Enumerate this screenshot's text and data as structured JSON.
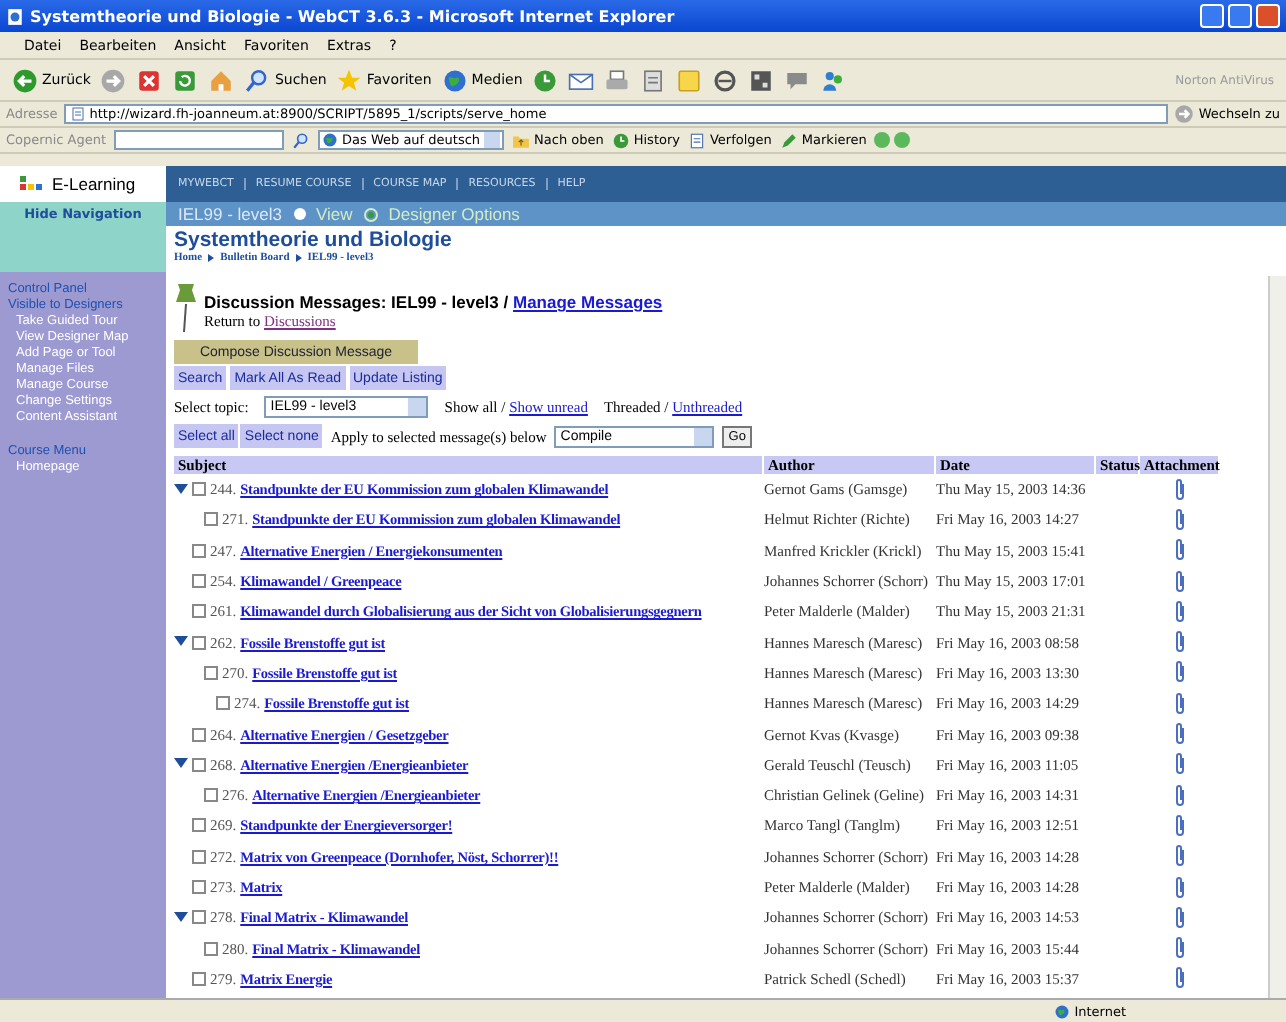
{
  "browser": {
    "title": "Systemtheorie und Biologie - WebCT 3.6.3 - Microsoft Internet Explorer",
    "menu": [
      "Datei",
      "Bearbeiten",
      "Ansicht",
      "Favoriten",
      "Extras",
      "?"
    ],
    "toolbar": [
      {
        "kind": "back",
        "label": "Zurück"
      },
      {
        "kind": "forward"
      },
      {
        "kind": "stop"
      },
      {
        "kind": "refresh"
      },
      {
        "kind": "home"
      },
      {
        "kind": "search",
        "label": "Suchen"
      },
      {
        "kind": "favorites",
        "label": "Favoriten"
      },
      {
        "kind": "media",
        "label": "Medien"
      },
      {
        "kind": "history"
      },
      {
        "kind": "mail"
      },
      {
        "kind": "print"
      },
      {
        "kind": "edit"
      },
      {
        "kind": "note"
      },
      {
        "kind": "ring"
      },
      {
        "kind": "grid"
      },
      {
        "kind": "chat"
      },
      {
        "kind": "people"
      }
    ],
    "norton": "Norton AntiVirus",
    "address_label": "Adresse",
    "url": "http://wizard.fh-joanneum.at:8900/SCRIPT/5895_1/scripts/serve_home",
    "go": "Wechseln zu",
    "copernic": {
      "label": "Copernic Agent",
      "engine": "Das Web auf deutsch",
      "buttons": [
        {
          "kind": "up",
          "label": "Nach oben"
        },
        {
          "kind": "history",
          "label": "History"
        },
        {
          "kind": "track",
          "label": "Verfolgen"
        },
        {
          "kind": "mark",
          "label": "Markieren"
        }
      ]
    },
    "status": "Internet"
  },
  "header": {
    "logo": "E-Learning",
    "nav": [
      "MYWEBCT",
      "RESUME COURSE",
      "COURSE MAP",
      "RESOURCES",
      "HELP"
    ],
    "hide_nav": "Hide Navigation",
    "course_code": "IEL99 - level3",
    "modes": [
      {
        "label": "View",
        "selected": false
      },
      {
        "label": "Designer Options",
        "selected": true
      }
    ]
  },
  "sidebar": {
    "sections": [
      {
        "items": [
          "Control Panel",
          "Visible to Designers"
        ],
        "children": [
          "Take Guided Tour",
          "View Designer Map",
          "Add Page or Tool",
          "Manage Files",
          "Manage Course",
          "Change Settings",
          "Content Assistant"
        ]
      },
      {
        "items": [
          "Course Menu"
        ],
        "children": [
          "Homepage"
        ]
      }
    ]
  },
  "page": {
    "course_title": "Systemtheorie und Biologie",
    "breadcrumb": [
      "Home",
      "Bulletin Board",
      "IEL99 - level3"
    ],
    "heading": "Discussion Messages: IEL99 - level3 / ",
    "heading_link": "Manage Messages",
    "return_text": "Return to ",
    "return_link": "Discussions",
    "compose": "Compose Discussion Message",
    "actions": [
      "Search",
      "Mark All As Read",
      "Update Listing"
    ],
    "topic_label": "Select topic:",
    "topic_value": "IEL99 - level3",
    "show_all": "Show all / ",
    "show_unread": "Show unread",
    "threaded": "Threaded / ",
    "unthreaded": "Unthreaded",
    "select_buttons": [
      "Select all",
      "Select none"
    ],
    "apply_label": "Apply to selected message(s) below",
    "apply_value": "Compile",
    "apply_go": "Go"
  },
  "table": {
    "columns": [
      "Subject",
      "Author",
      "Date",
      "Status",
      "Attachment"
    ],
    "messages": [
      {
        "number": "244.",
        "subject": "Standpunkte der EU Kommission zum globalen Klimawandel",
        "author": "Gernot Gams (Gamsge)",
        "date": "Thu May 15, 2003 14:36",
        "checked": false,
        "attachment": true,
        "expanded": true,
        "children": [
          {
            "number": "271.",
            "subject": "Standpunkte der EU Kommission zum globalen Klimawandel",
            "author": "Helmut Richter (Richte)",
            "date": "Fri May 16, 2003 14:27",
            "checked": false,
            "attachment": true
          }
        ]
      },
      {
        "number": "247.",
        "subject": "Alternative Energien / Energiekonsumenten",
        "author": "Manfred Krickler (Krickl)",
        "date": "Thu May 15, 2003 15:41",
        "checked": false,
        "attachment": true
      },
      {
        "number": "254.",
        "subject": "Klimawandel / Greenpeace",
        "author": "Johannes Schorrer (Schorr)",
        "date": "Thu May 15, 2003 17:01",
        "checked": false,
        "attachment": true
      },
      {
        "number": "261.",
        "subject": "Klimawandel durch Globalisierung aus der Sicht von Globalisierungsgegnern",
        "author": "Peter Malderle (Malder)",
        "date": "Thu May 15, 2003 21:31",
        "checked": false,
        "attachment": true
      },
      {
        "number": "262.",
        "subject": "Fossile Brenstoffe gut ist",
        "author": "Hannes Maresch (Maresc)",
        "date": "Fri May 16, 2003 08:58",
        "checked": false,
        "attachment": true,
        "expanded": true,
        "children": [
          {
            "number": "270.",
            "subject": "Fossile Brenstoffe gut ist",
            "author": "Hannes Maresch (Maresc)",
            "date": "Fri May 16, 2003 13:30",
            "checked": false,
            "attachment": true,
            "children": [
              {
                "number": "274.",
                "subject": "Fossile Brenstoffe gut ist",
                "author": "Hannes Maresch (Maresc)",
                "date": "Fri May 16, 2003 14:29",
                "checked": false,
                "attachment": true
              }
            ]
          }
        ]
      },
      {
        "number": "264.",
        "subject": "Alternative Energien / Gesetzgeber",
        "author": "Gernot Kvas (Kvasge)",
        "date": "Fri May 16, 2003 09:38",
        "checked": false,
        "attachment": true
      },
      {
        "number": "268.",
        "subject": "Alternative Energien /Energieanbieter",
        "author": "Gerald Teuschl (Teusch)",
        "date": "Fri May 16, 2003 11:05",
        "checked": false,
        "attachment": true,
        "expanded": true,
        "children": [
          {
            "number": "276.",
            "subject": "Alternative Energien /Energieanbieter",
            "author": "Christian Gelinek (Geline)",
            "date": "Fri May 16, 2003 14:31",
            "checked": false,
            "attachment": true
          }
        ]
      },
      {
        "number": "269.",
        "subject": "Standpunkte der Energieversorger!",
        "author": "Marco Tangl (Tanglm)",
        "date": "Fri May 16, 2003 12:51",
        "checked": false,
        "attachment": true
      },
      {
        "number": "272.",
        "subject": "Matrix von Greenpeace (Dornhofer, Nöst, Schorrer)!!",
        "author": "Johannes Schorrer (Schorr)",
        "date": "Fri May 16, 2003 14:28",
        "checked": false,
        "attachment": true
      },
      {
        "number": "273.",
        "subject": "Matrix",
        "author": "Peter Malderle (Malder)",
        "date": "Fri May 16, 2003 14:28",
        "checked": false,
        "attachment": true
      },
      {
        "number": "278.",
        "subject": "Final Matrix - Klimawandel",
        "author": "Johannes Schorrer (Schorr)",
        "date": "Fri May 16, 2003 14:53",
        "checked": false,
        "attachment": true,
        "expanded": true,
        "children": [
          {
            "number": "280.",
            "subject": "Final Matrix - Klimawandel",
            "author": "Johannes Schorrer (Schorr)",
            "date": "Fri May 16, 2003 15:44",
            "checked": false,
            "attachment": true
          }
        ]
      },
      {
        "number": "279.",
        "subject": "Matrix Energie",
        "author": "Patrick Schedl (Schedl)",
        "date": "Fri May 16, 2003 15:37",
        "checked": false,
        "attachment": true
      }
    ]
  }
}
